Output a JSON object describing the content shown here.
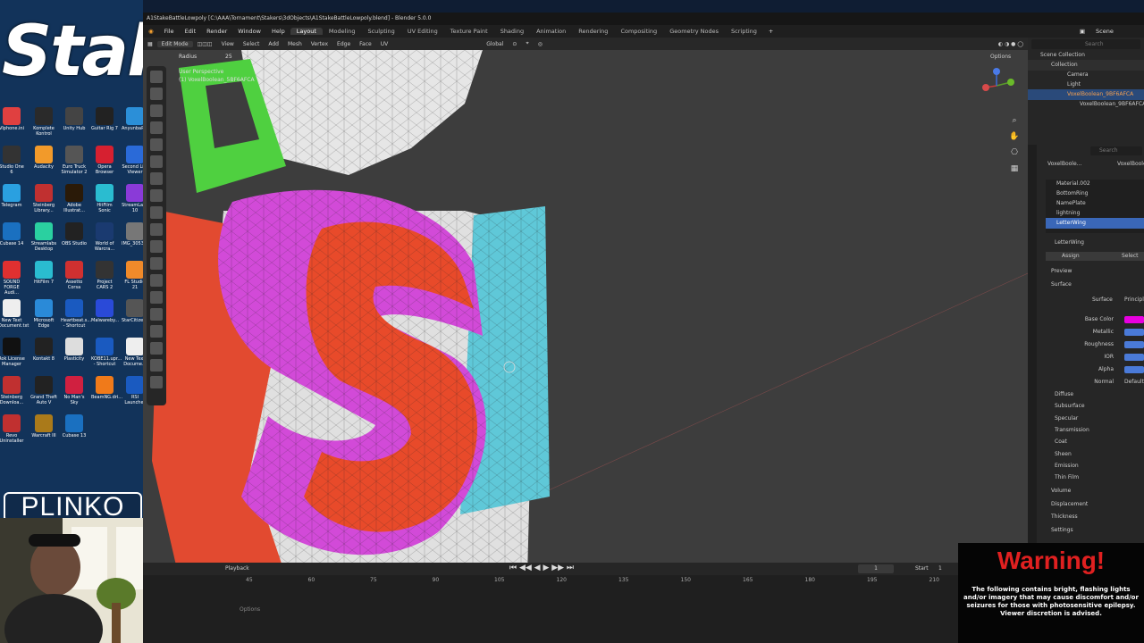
{
  "stream_overlay": {
    "logo_text": "Stake",
    "plinko_text": "PLINKO",
    "warning_title": "Warning!",
    "warning_text": "The following contains bright, flashing lights and/or imagery that may cause discomfort and/or seizures for those with photosensitive epilepsy. Viewer discretion is advised."
  },
  "desktop_icons": [
    {
      "label": "Vlphone.ini",
      "color": "#e04040"
    },
    {
      "label": "Komplete Kontrol",
      "color": "#2a2a2a"
    },
    {
      "label": "Unity Hub",
      "color": "#444"
    },
    {
      "label": "Guitar Rig 7",
      "color": "#222"
    },
    {
      "label": "AnyunbaPh...",
      "color": "#2b8fd8"
    },
    {
      "label": "Studio One 6",
      "color": "#333"
    },
    {
      "label": "Audacity",
      "color": "#f29a2a"
    },
    {
      "label": "Euro Truck Simulator 2",
      "color": "#555"
    },
    {
      "label": "Opera Browser",
      "color": "#d62030"
    },
    {
      "label": "Second Life Viewer",
      "color": "#2a6ad8"
    },
    {
      "label": "Telegram",
      "color": "#2aa0e0"
    },
    {
      "label": "Steinberg Library...",
      "color": "#c03030"
    },
    {
      "label": "Adobe Illustrat...",
      "color": "#2a1a08"
    },
    {
      "label": "HitFilm Sonic",
      "color": "#2abcd0"
    },
    {
      "label": "StreamLabs 10",
      "color": "#8a3ad8"
    },
    {
      "label": "Cubase 14",
      "color": "#1a70c0"
    },
    {
      "label": "Streamlabs Desktop",
      "color": "#2ad0a0"
    },
    {
      "label": "OBS Studio",
      "color": "#222"
    },
    {
      "label": "World of Warcra...",
      "color": "#1a3a70"
    },
    {
      "label": "IMG_3053.H...",
      "color": "#777"
    },
    {
      "label": "SOUND FORGE Audi...",
      "color": "#e03030"
    },
    {
      "label": "HitFilm 7",
      "color": "#2abcd0"
    },
    {
      "label": "Assetto Corsa",
      "color": "#d03030"
    },
    {
      "label": "Project CARS 2",
      "color": "#333"
    },
    {
      "label": "FL Studio 21",
      "color": "#f08a2a"
    },
    {
      "label": "New Text Document.txt",
      "color": "#eee"
    },
    {
      "label": "Microsoft Edge",
      "color": "#2a8ad8"
    },
    {
      "label": "Heartbeat.s... - Shortcut",
      "color": "#1a5ac0"
    },
    {
      "label": "Malwareby...",
      "color": "#2a4ad8"
    },
    {
      "label": "StarCitizen...",
      "color": "#555"
    },
    {
      "label": "Rok License Manager",
      "color": "#111"
    },
    {
      "label": "Kontakt 8",
      "color": "#222"
    },
    {
      "label": "Plasticity",
      "color": "#ddd"
    },
    {
      "label": "KOBE11.upr... - Shortcut",
      "color": "#1a5ac0"
    },
    {
      "label": "New Text Docume...",
      "color": "#eee"
    },
    {
      "label": "Steinberg Downloa...",
      "color": "#c03030"
    },
    {
      "label": "Grand Theft Auto V",
      "color": "#222"
    },
    {
      "label": "No Man's Sky",
      "color": "#d02040"
    },
    {
      "label": "BeamNG.dri...",
      "color": "#f07a1a"
    },
    {
      "label": "RSI Launcher",
      "color": "#1a5ac0"
    },
    {
      "label": "Revo Uninstaller",
      "color": "#c03030"
    },
    {
      "label": "Warcraft III",
      "color": "#aa7a1a"
    },
    {
      "label": "Cubase 13",
      "color": "#1a70c0"
    }
  ],
  "blender": {
    "title": "A1StakeBattleLowpoly [C:\\AAA\\Tornament\\Stakers\\3dObjects\\A1StakeBattleLowpoly.blend] - Blender 5.0.0",
    "menus": [
      "File",
      "Edit",
      "Render",
      "Window",
      "Help"
    ],
    "workspaces": [
      "Layout",
      "Modeling",
      "Sculpting",
      "UV Editing",
      "Texture Paint",
      "Shading",
      "Animation",
      "Rendering",
      "Compositing",
      "Geometry Nodes",
      "Scripting"
    ],
    "active_workspace": "Layout",
    "scene_label": "Scene",
    "viewport_header": {
      "mode": "Edit Mode",
      "menus": [
        "View",
        "Select",
        "Add",
        "Mesh",
        "Vertex",
        "Edge",
        "Face",
        "UV"
      ],
      "orientation": "Global",
      "options": "Options"
    },
    "viewport_overlay": {
      "radius_label": "Radius",
      "radius_value": "25",
      "perspective": "User Perspective",
      "object": "(1) VoxelBoolean_5BF6AFCA"
    },
    "outliner": {
      "search_placeholder": "Search",
      "items": [
        "Scene Collection",
        "Collection",
        "Camera",
        "Light",
        "VoxelBoolean_9BF6AFCA",
        "VoxelBoolean_9BF6AFCA"
      ]
    },
    "properties": {
      "object_label": "VoxelBoole...",
      "object_label2": "VoxelBoole...",
      "search_placeholder": "Search",
      "materials": [
        "Material.002",
        "BottomRing",
        "NamePlate",
        "lightning",
        "LetterWing"
      ],
      "active_material": "LetterWing",
      "material_slot": "LetterWing",
      "assign": "Assign",
      "select": "Select",
      "preview": "Preview",
      "surface": "Surface",
      "surface_value": "Principl",
      "fields": [
        {
          "label": "Base Color",
          "color": "#e800e0"
        },
        {
          "label": "Metallic",
          "color": "#4a7ad8"
        },
        {
          "label": "Roughness",
          "color": "#4a7ad8"
        },
        {
          "label": "IOR",
          "color": "#4a7ad8"
        },
        {
          "label": "Alpha",
          "color": "#4a7ad8"
        },
        {
          "label": "Normal",
          "value": "Default"
        }
      ],
      "sections": [
        "Diffuse",
        "Subsurface",
        "Specular",
        "Transmission",
        "Coat",
        "Sheen",
        "Emission",
        "Thin Film"
      ],
      "lower_sections": [
        "Volume",
        "Displacement",
        "Thickness",
        "Settings"
      ]
    },
    "timeline": {
      "playback": "Playback",
      "current_frame": "1",
      "start_label": "Start",
      "start_value": "1",
      "ticks": [
        "45",
        "60",
        "75",
        "90",
        "105",
        "120",
        "135",
        "150",
        "165",
        "180",
        "195",
        "210"
      ],
      "options": "Options"
    }
  }
}
